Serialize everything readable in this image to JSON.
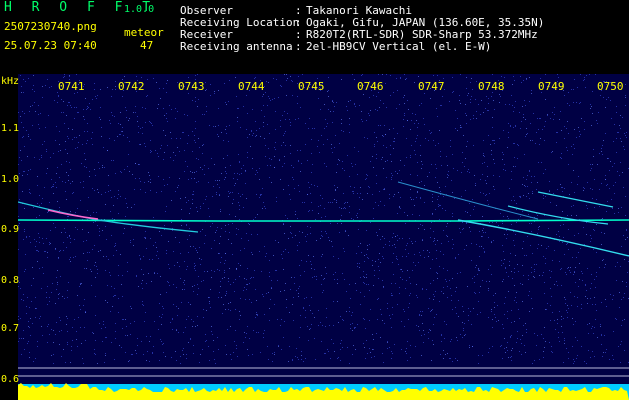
{
  "app": {
    "name": "H R O F F T",
    "version": "1.0.0"
  },
  "file": {
    "name": "2507230740.png",
    "datetime": "25.07.23 07:40"
  },
  "counter": {
    "label": "meteor",
    "value": "47"
  },
  "info": [
    {
      "label": "Observer",
      "sep": ":",
      "value": "Takanori Kawachi"
    },
    {
      "label": "Receiving Location",
      "sep": ":",
      "value": "Ogaki, Gifu, JAPAN (136.60E, 35.35N)"
    },
    {
      "label": "Receiver",
      "sep": ":",
      "value": "R820T2(RTL-SDR) SDR-Sharp 53.372MHz"
    },
    {
      "label": "Receiving antenna",
      "sep": ":",
      "value": "2el-HB9CV Vertical (el. E-W)"
    }
  ],
  "axis": {
    "y_unit": "kHz",
    "x_ticks": [
      "0741",
      "0742",
      "0743",
      "0744",
      "0745",
      "0746",
      "0747",
      "0748",
      "0749",
      "0750"
    ],
    "y_ticks": [
      "1.1",
      "1.0",
      "0.9",
      "0.8",
      "0.7",
      "0.6"
    ]
  },
  "colors": {
    "label": "#ffff00",
    "title": "#00ff6a",
    "background": "#000044",
    "trace": "#00ffcc",
    "level": "#ffff00",
    "level_base": "#00ccff"
  }
}
